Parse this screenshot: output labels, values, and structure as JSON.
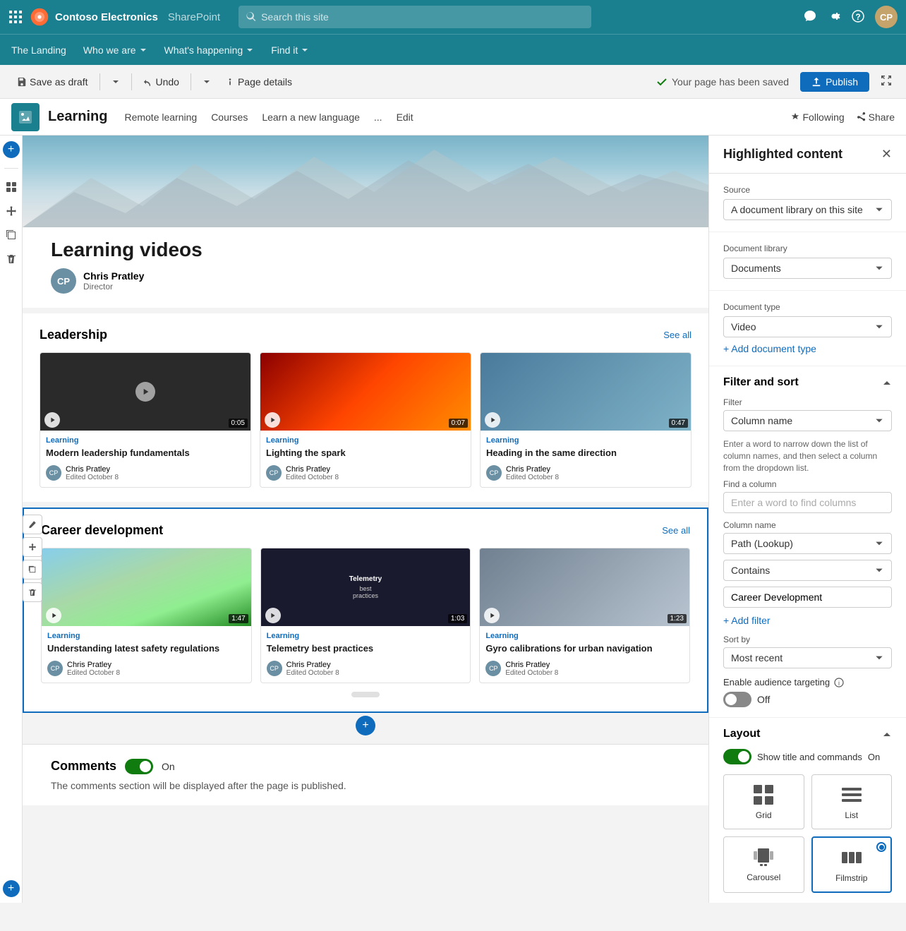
{
  "app": {
    "brand": "Contoso Electronics",
    "product": "SharePoint",
    "search_placeholder": "Search this site"
  },
  "site_nav": {
    "items": [
      {
        "label": "The Landing",
        "has_dropdown": false
      },
      {
        "label": "Who we are",
        "has_dropdown": true
      },
      {
        "label": "What's happening",
        "has_dropdown": true
      },
      {
        "label": "Find it",
        "has_dropdown": true
      }
    ]
  },
  "page_toolbar": {
    "save_draft": "Save as draft",
    "undo": "Undo",
    "page_details": "Page details",
    "saved_status": "Your page has been saved",
    "publish": "Publish"
  },
  "sub_nav": {
    "icon_label": "Learning",
    "items": [
      "Remote learning",
      "Courses",
      "Learn a new language"
    ],
    "more": "...",
    "edit": "Edit",
    "following": "Following",
    "share": "Share"
  },
  "page": {
    "title": "Learning videos",
    "author_name": "Chris Pratley",
    "author_title": "Director"
  },
  "sections": {
    "leadership": {
      "title": "Leadership",
      "see_all": "See all",
      "videos": [
        {
          "tag": "Learning",
          "title": "Modern leadership fundamentals",
          "author": "Chris Pratley",
          "edited": "Edited October 8",
          "duration": "0:05",
          "thumb_class": "thumb-dark"
        },
        {
          "tag": "Learning",
          "title": "Lighting the spark",
          "author": "Chris Pratley",
          "edited": "Edited October 8",
          "duration": "0:07",
          "thumb_class": "thumb-fire"
        },
        {
          "tag": "Learning",
          "title": "Heading in the same direction",
          "author": "Chris Pratley",
          "edited": "Edited October 8",
          "duration": "0:47",
          "thumb_class": "thumb-office"
        }
      ]
    },
    "career": {
      "title": "Career development",
      "see_all": "See all",
      "videos": [
        {
          "tag": "Learning",
          "title": "Understanding latest safety regulations",
          "author": "Chris Pratley",
          "edited": "Edited October 8",
          "duration": "1:47",
          "thumb_class": "thumb-drone"
        },
        {
          "tag": "Learning",
          "title": "Telemetry best practices",
          "author": "Chris Pratley",
          "edited": "Edited October 8",
          "duration": "1:03",
          "thumb_class": "thumb-telemetry"
        },
        {
          "tag": "Learning",
          "title": "Gyro calibrations for urban navigation",
          "author": "Chris Pratley",
          "edited": "Edited October 8",
          "duration": "1:23",
          "thumb_class": "thumb-city"
        }
      ]
    }
  },
  "comments": {
    "label": "Comments",
    "toggle_state": "On",
    "description": "The comments section will be displayed after the page is published."
  },
  "panel": {
    "title": "Highlighted content",
    "source_label": "Source",
    "source_value": "A document library on this site",
    "document_library_label": "Document library",
    "document_library_value": "Documents",
    "document_type_label": "Document type",
    "document_type_value": "Video",
    "add_document_type": "+ Add document type",
    "filter_sort_label": "Filter and sort",
    "filter_label": "Filter",
    "filter_value": "Column name",
    "filter_hint": "Enter a word to narrow down the list of column names, and then select a column from the dropdown list.",
    "find_column_label": "Find a column",
    "find_column_placeholder": "Enter a word to find columns",
    "column_name_label": "Column name",
    "column_name_value": "Path (Lookup)",
    "contains_value": "Contains",
    "filter_value_input": "Career Development",
    "add_filter": "+ Add filter",
    "sort_by_label": "Sort by",
    "sort_by_value": "Most recent",
    "audience_label": "Enable audience targeting",
    "audience_state": "Off",
    "layout_label": "Layout",
    "show_title_label": "Show title and commands",
    "show_title_state": "On",
    "layout_options": [
      {
        "label": "Grid",
        "selected": false
      },
      {
        "label": "List",
        "selected": false
      },
      {
        "label": "Carousel",
        "selected": false
      },
      {
        "label": "Filmstrip",
        "selected": true
      }
    ]
  }
}
